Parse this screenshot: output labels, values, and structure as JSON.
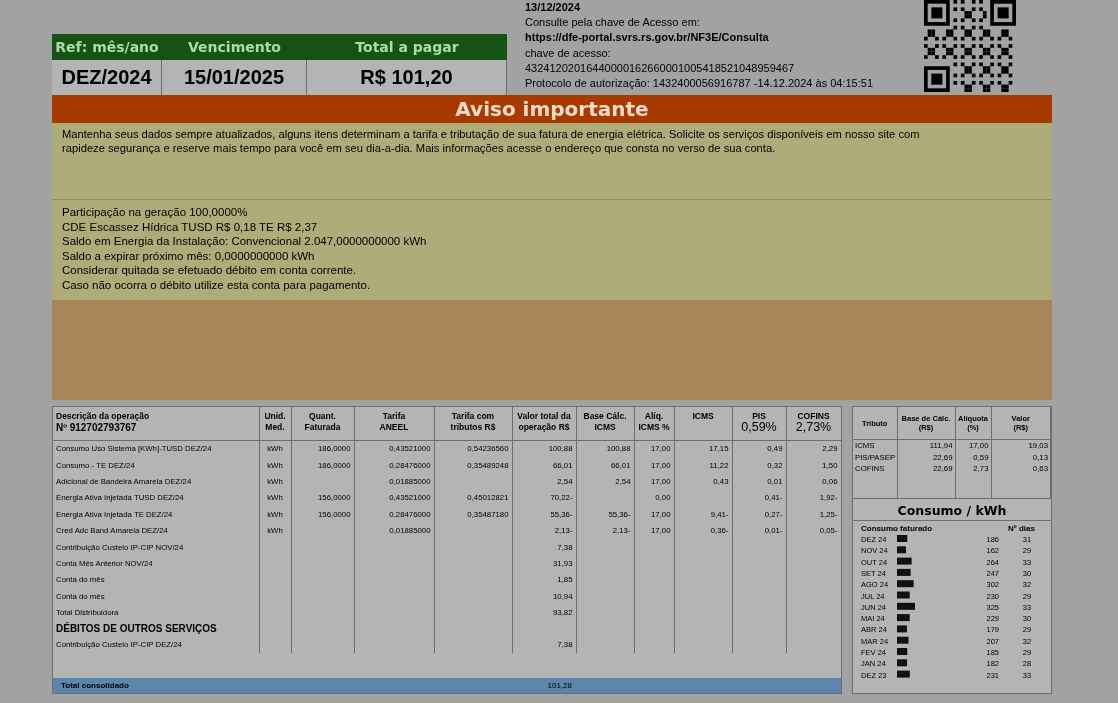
{
  "access_info": {
    "date": "13/12/2024",
    "consult_label": "Consulte pela chave de Acesso em:",
    "url": "https://dfe-portal.svrs.rs.gov.br/NF3E/Consulta",
    "key_label": "chave de acesso:",
    "key": "43241202016440000162660001005418521048959467",
    "protocol": "Protocolo de autorização: 1432400056916787 -14.12.2024 às 04:15:51"
  },
  "summary": {
    "columns": [
      "Ref: mês/ano",
      "Vencimento",
      "Total a pagar"
    ],
    "values": [
      "DEZ/2024",
      "15/01/2025",
      "R$ 101,20"
    ]
  },
  "notice": {
    "title": "Aviso importante",
    "message": "Mantenha seus dados sempre atualizados, alguns itens determinam a tarifa e tributação de sua fatura de energia elétrica. Solicite os serviços disponíveis em nosso site com rapideze segurança e reserve mais tempo para você em seu dia-a-dia. Mais informações acesse o endereço que consta no verso de sua conta.",
    "details": [
      "Participação na geração 100,0000%",
      "CDE Escassez Hídrica  TUSD R$ 0,18  TE R$ 2,37",
      "Saldo em Energia da Instalação: Convencional 2.047,0000000000 kWh",
      "Saldo a expirar próximo mês: 0,0000000000 kWh",
      "Considerar quitada se efetuado débito em conta corrente.",
      "Caso não ocorra o débito utilize esta conta para pagamento."
    ]
  },
  "operations": {
    "columns": [
      {
        "label": "Descrição da operação",
        "sub": "Nº 912702793767"
      },
      {
        "label": "Unid.\nMed."
      },
      {
        "label": "Quant.\nFaturada"
      },
      {
        "label": "Tarifa\nANEEL"
      },
      {
        "label": "Tarifa com\ntributos R$"
      },
      {
        "label": "Valor total da\noperação R$"
      },
      {
        "label": "Base Cálc.\nICMS"
      },
      {
        "label": "Alíq.\nICMS %"
      },
      {
        "label": "ICMS"
      },
      {
        "label": "PIS",
        "sub": "0,59%"
      },
      {
        "label": "COFINS",
        "sub": "2,73%"
      }
    ],
    "rows": [
      {
        "kind": "item",
        "cells": [
          "Consumo Uso Sistema [KWh]-TUSD DEZ/24",
          "kWh",
          "186,0000",
          "0,43521000",
          "0,54236560",
          "100,88",
          "100,88",
          "17,00",
          "17,15",
          "0,49",
          "2,29"
        ]
      },
      {
        "kind": "item",
        "cells": [
          "Consumo - TE DEZ/24",
          "kWh",
          "186,0000",
          "0,28476000",
          "0,35489248",
          "66,01",
          "66,01",
          "17,00",
          "11,22",
          "0,32",
          "1,50"
        ]
      },
      {
        "kind": "item",
        "cells": [
          "Adicional de Bandeira Amarela DEZ/24",
          "kWh",
          null,
          "0,01885000",
          null,
          "2,54",
          "2,54",
          "17,00",
          "0,43",
          "0,01",
          "0,06"
        ]
      },
      {
        "kind": "item",
        "cells": [
          "Energia Ativa Injetada TUSD DEZ/24",
          "kWh",
          "156,0000",
          "0,43521000",
          "0,45012821",
          "70,22-",
          null,
          "0,00",
          null,
          "0,41-",
          "1,92-"
        ]
      },
      {
        "kind": "item",
        "cells": [
          "Energia Ativa Injetada TE DEZ/24",
          "kWh",
          "156,0000",
          "0,28476000",
          "0,35487180",
          "55,36-",
          "55,36-",
          "17,00",
          "9,41-",
          "0,27-",
          "1,25-"
        ]
      },
      {
        "kind": "item",
        "cells": [
          "Cred Adc Band Amarela DEZ/24",
          "kWh",
          null,
          "0,01885000",
          null,
          "2,13-",
          "2,13-",
          "17,00",
          "0,36-",
          "0,01-",
          "0,05-"
        ]
      },
      {
        "kind": "item",
        "cells": [
          "Contribuição Custeio IP-CIP NOV/24",
          null,
          null,
          null,
          null,
          "7,38"
        ]
      },
      {
        "kind": "item",
        "cells": [
          "Conta Mês Anterior NOV/24",
          null,
          null,
          null,
          null,
          "31,93"
        ]
      },
      {
        "kind": "item",
        "cells": [
          "Conta do mês",
          null,
          null,
          null,
          null,
          "1,85"
        ]
      },
      {
        "kind": "item",
        "cells": [
          "Conta do mês",
          null,
          null,
          null,
          null,
          "10,94"
        ]
      },
      {
        "kind": "item",
        "cells": [
          "Total Distribuidora",
          null,
          null,
          null,
          null,
          "93,82"
        ]
      },
      {
        "kind": "section",
        "cells": [
          "DÉBITOS DE OUTROS SERVIÇOS"
        ]
      },
      {
        "kind": "item",
        "cells": [
          "Contribuição Custeio IP-CIP DEZ/24",
          null,
          null,
          null,
          null,
          "7,38"
        ]
      }
    ],
    "total": {
      "label": "Total consolidado",
      "value": "101,28"
    }
  },
  "taxes": {
    "columns": [
      "Tributo",
      "Base de Cálc.\n(R$)",
      "Alíquota\n(%)",
      "Valor\n(R$)"
    ],
    "rows": [
      [
        "ICMS",
        "111,94",
        "17,00",
        "19,03"
      ],
      [
        "PIS/PASEP",
        "22,69",
        "0,59",
        "0,13"
      ],
      [
        "COFINS",
        "22,69",
        "2,73",
        "0,63"
      ]
    ]
  },
  "consumption": {
    "title": "Consumo / kWh",
    "label": "Consumo faturado",
    "days_label": "Nº dias",
    "days": [
      "31",
      "29",
      "33",
      "30",
      "32",
      "29",
      "33",
      "30",
      "29",
      "32",
      "29",
      "28",
      "33"
    ],
    "chart_data": {
      "type": "bar",
      "orientation": "horizontal",
      "data_labels": true,
      "categories": [
        "DEZ 24",
        "NOV 24",
        "OUT 24",
        "SET 24",
        "AGO 24",
        "JUL 24",
        "JUN 24",
        "MAI 24",
        "ABR 24",
        "MAR 24",
        "FEV 24",
        "JAN 24",
        "DEZ 23"
      ],
      "values": [
        186,
        162,
        264,
        247,
        302,
        230,
        325,
        229,
        179,
        207,
        185,
        182,
        231
      ]
    }
  }
}
